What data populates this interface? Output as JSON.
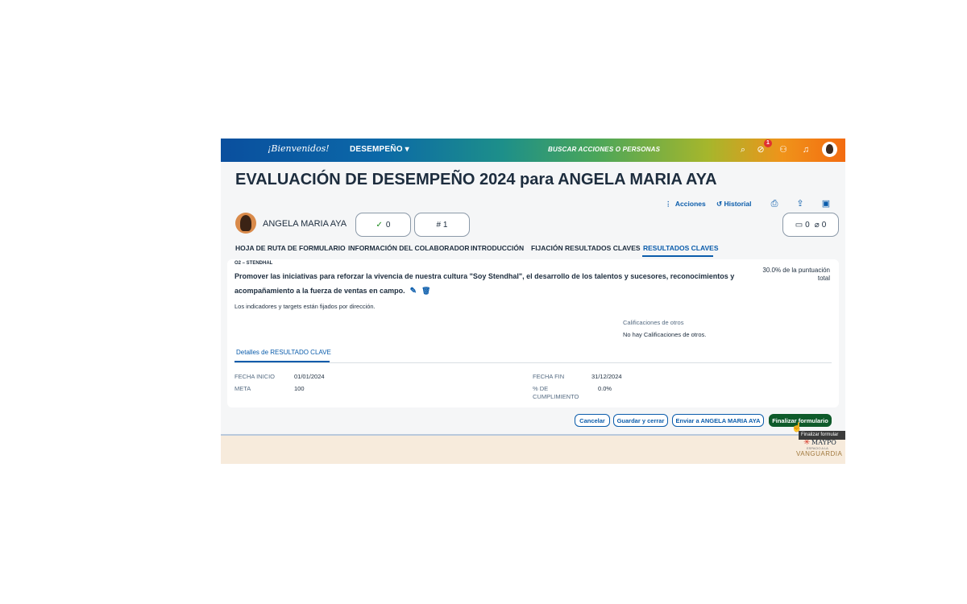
{
  "header": {
    "brand": "¡Bienvenidos!",
    "module": "DESEMPEÑO ▾",
    "search_placeholder": "BUSCAR ACCIONES O PERSONAS",
    "notification_count": "1"
  },
  "page": {
    "title": "EVALUACIÓN DE DESEMPEÑO 2024 para ANGELA MARIA AYA"
  },
  "toolbar": {
    "actions_label": "Acciones",
    "history_label": "Historial"
  },
  "employee": {
    "name": "ANGELA MARIA AYA",
    "check_count": "0",
    "hash_count": "# 1",
    "comments": "0",
    "attachments": "0"
  },
  "tabs": [
    {
      "label": "HOJA DE RUTA DE FORMULARIO"
    },
    {
      "label": "INFORMACIÓN DEL COLABORADOR"
    },
    {
      "label": "INTRODUCCIÓN"
    },
    {
      "label": "FIJACIÓN RESULTADOS CLAVES"
    },
    {
      "label": "RESULTADOS CLAVES"
    }
  ],
  "objective": {
    "code": "O2 – STENDHAL",
    "text": "Promover las iniciativas para reforzar la vivencia de nuestra cultura \"Soy Stendhal\", el desarrollo de los talentos y sucesores, reconocimientos y acompañamiento a la fuerza de ventas en campo.",
    "weight": "30.0% de la puntuación total",
    "note": "Los indicadores y targets están fijados por dirección.",
    "others_title": "Calificaciones de otros",
    "others_empty": "No hay Calificaciones de otros.",
    "details_tab": "Detalles de RESULTADO CLAVE",
    "fields": {
      "start_label": "FECHA INICIO",
      "start_value": "01/01/2024",
      "end_label": "FECHA FIN",
      "end_value": "31/12/2024",
      "goal_label": "META",
      "goal_value": "100",
      "completion_label": "% DE CUMPLIMIENTO",
      "completion_value": "0.0%"
    }
  },
  "buttons": {
    "cancel": "Cancelar",
    "save_close": "Guardar y cerrar",
    "send": "Enviar a ANGELA MARIA AYA",
    "finalize": "Finalizar formulario"
  },
  "tooltip": "Finalizar formular",
  "footer": {
    "logo_line1": "MAYPO",
    "logo_line2": "ESPACIO A LA",
    "logo_line3": "VANGUARDIA"
  },
  "colors": {
    "accent": "#0a5cab",
    "primary_button": "#0e5a2a",
    "badge": "#e03131"
  }
}
